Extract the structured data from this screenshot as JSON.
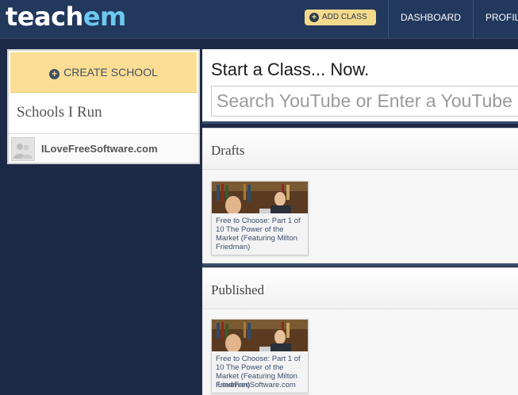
{
  "header": {
    "logo_part1": "teach",
    "logo_part2": "em",
    "add_class_label": "ADD CLASS",
    "nav": [
      "DASHBOARD",
      "PROFILE"
    ]
  },
  "sidebar": {
    "create_school_label": "CREATE SCHOOL",
    "schools_title": "Schools I Run",
    "schools": [
      {
        "name": "ILoveFreeSoftware.com"
      }
    ]
  },
  "main": {
    "title": "Start a Class... Now.",
    "search_placeholder": "Search YouTube or Enter a YouTube URL"
  },
  "drafts": {
    "title": "Drafts",
    "items": [
      {
        "title": "Free to Choose: Part 1 of 10 The Power of the Market (Featuring Milton Friedman)"
      }
    ]
  },
  "published": {
    "title": "Published",
    "items": [
      {
        "title": "Free to Choose: Part 1 of 10 The Power of the Market (Featuring Milton Friedman)",
        "school": "ILoveFreeSoftware.com"
      }
    ]
  },
  "colors": {
    "topbar": "#22385c",
    "page_bg": "#1d2a47",
    "accent_yellow": "#fbde93",
    "logo_accent": "#6bc8f0"
  }
}
